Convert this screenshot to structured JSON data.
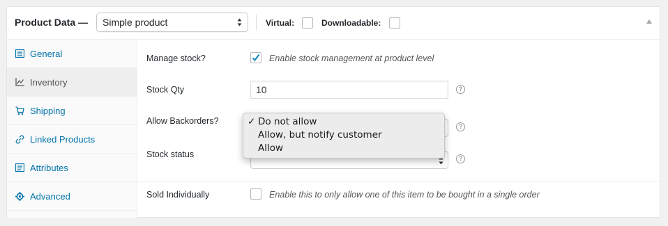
{
  "header": {
    "title": "Product Data —",
    "product_type": "Simple product",
    "virtual_label": "Virtual:",
    "downloadable_label": "Downloadable:",
    "virtual_checked": false,
    "downloadable_checked": false
  },
  "tabs": [
    {
      "label": "General",
      "icon": "general-icon",
      "active": false
    },
    {
      "label": "Inventory",
      "icon": "inventory-icon",
      "active": true
    },
    {
      "label": "Shipping",
      "icon": "shipping-icon",
      "active": false
    },
    {
      "label": "Linked Products",
      "icon": "link-icon",
      "active": false
    },
    {
      "label": "Attributes",
      "icon": "attributes-icon",
      "active": false
    },
    {
      "label": "Advanced",
      "icon": "gear-icon",
      "active": false
    }
  ],
  "inventory": {
    "manage_stock_label": "Manage stock?",
    "manage_stock_desc": "Enable stock management at product level",
    "manage_stock_checked": true,
    "stock_qty_label": "Stock Qty",
    "stock_qty_value": "10",
    "backorders_label": "Allow Backorders?",
    "stock_status_label": "Stock status",
    "sold_individually_label": "Sold Individually",
    "sold_individually_desc": "Enable this to only allow one of this item to be bought in a single order",
    "sold_individually_checked": false,
    "help_glyph": "?"
  },
  "backorders_dropdown": {
    "selected": "Do not allow",
    "check_glyph": "✓",
    "options": [
      "Do not allow",
      "Allow, but notify customer",
      "Allow"
    ]
  },
  "colors": {
    "link": "#0073aa",
    "active_tab_bg": "#eeeeee",
    "checkbox_check": "#1e8cbe"
  }
}
